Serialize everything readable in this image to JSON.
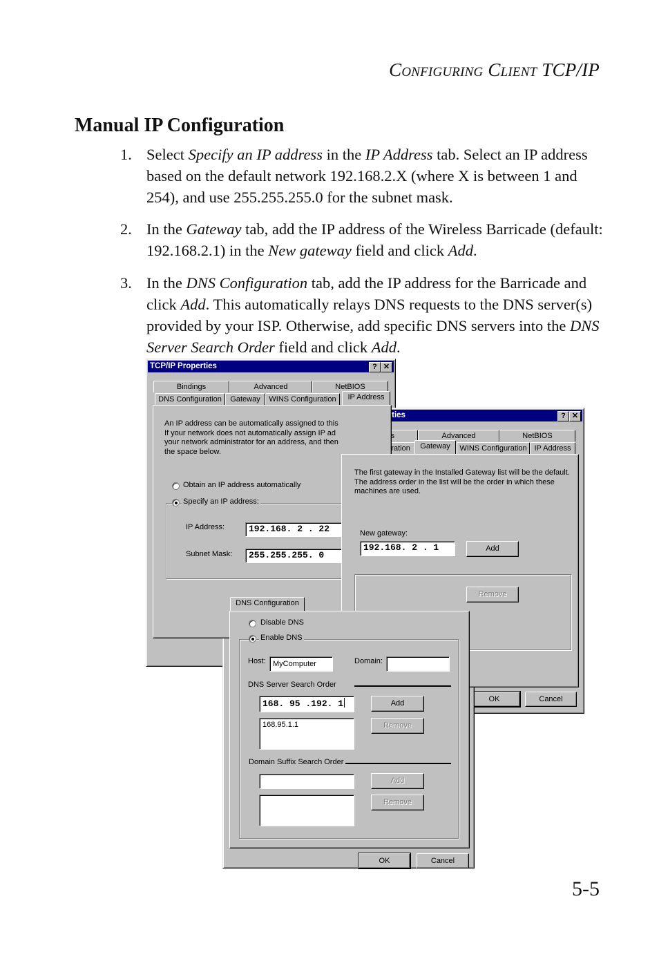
{
  "running_head": {
    "small_caps": "Configuring Client",
    "rest": "TCP/IP"
  },
  "section_title": "Manual IP Configuration",
  "steps": [
    {
      "num": "1.",
      "parts": [
        "Select ",
        "Specify an IP address",
        " in the ",
        "IP Address",
        " tab. Select an IP address based on the default network 192.168.2.X (where X is between 1 and 254), and use 255.255.255.0 for the subnet mask."
      ]
    },
    {
      "num": "2.",
      "parts": [
        "In the ",
        "Gateway",
        " tab, add the IP address of the Wireless Barricade (default: 192.168.2.1) in the ",
        "New gateway",
        " field and click ",
        "Add",
        "."
      ]
    },
    {
      "num": "3.",
      "parts": [
        "In the ",
        "DNS Configuration",
        " tab, add the IP address for the Barricade and click ",
        "Add",
        ". This automatically relays DNS requests to the DNS server(s) provided by your ISP. Otherwise, add specific DNS servers into the ",
        "DNS Server Search Order",
        " field and click ",
        "Add",
        "."
      ]
    }
  ],
  "page_number": "5-5",
  "dialogs": {
    "title": "TCP/IP Properties",
    "help_glyph": "?",
    "close_glyph": "✕",
    "tabs_row1": [
      "Bindings",
      "Advanced",
      "NetBIOS"
    ],
    "tabs_row2": [
      "DNS Configuration",
      "Gateway",
      "WINS Configuration",
      "IP Address"
    ],
    "ip_address": {
      "active_tab": "IP Address",
      "description": "An IP address can be automatically assigned to this computer. If your network does not automatically assign IP addresses, ask your network administrator for an address, and then type it in the space below.",
      "desc_lines": [
        "An IP address can be automatically assigned to this",
        "If your network does not automatically assign IP ad",
        "your network administrator for an address, and then",
        "the space below."
      ],
      "radio_obtain": "Obtain an IP address automatically",
      "radio_specify": "Specify an IP address:",
      "selected": "specify",
      "ip_label": "IP Address:",
      "ip_value": "192.168. 2 . 22",
      "mask_label": "Subnet Mask:",
      "mask_value": "255.255.255. 0"
    },
    "gateway": {
      "active_tab": "Gateway",
      "desc_lines": [
        "The first gateway in the Installed Gateway list will be the default.",
        "The address order in the list will be the order in which these",
        "machines are used."
      ],
      "new_gateway_label": "New gateway:",
      "new_gateway_value": "192.168. 2 . 1",
      "add_label": "Add",
      "remove_label": "Remove",
      "ok_label": "OK",
      "cancel_label": "Cancel"
    },
    "dns": {
      "active_tab": "DNS Configuration",
      "radio_disable": "Disable DNS",
      "radio_enable": "Enable DNS",
      "selected": "enable",
      "host_label": "Host:",
      "host_value": "MyComputer",
      "domain_label": "Domain:",
      "domain_value": "",
      "server_order_label": "DNS Server Search Order",
      "server_input_value": "168. 95 .192. 1",
      "server_list": [
        "168.95.1.1"
      ],
      "suffix_label": "Domain Suffix Search Order",
      "suffix_input_value": "",
      "add_label": "Add",
      "remove_label": "Remove",
      "ok_label": "OK",
      "cancel_label": "Cancel"
    }
  }
}
